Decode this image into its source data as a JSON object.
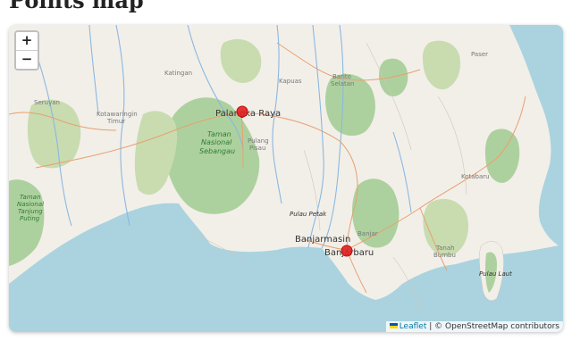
{
  "page": {
    "title": "Points map"
  },
  "map": {
    "colors": {
      "sea": "#aad3df",
      "land": "#f2efe9",
      "forest": "#add19e",
      "park": "#c8dcb0",
      "marker": "#e02020",
      "river": "#8ab8e0",
      "road": "#e8a070"
    },
    "places": {
      "palangka_raya": "Palangka Raya",
      "banjarmasin": "Banjarmasin",
      "banjarbaru": "Banjarbaru",
      "kapuas": "Kapuas",
      "katingan": "Katingan",
      "seruyan": "Seruyan",
      "kotawaringin_1": "Kotawaringin",
      "kotawaringin_2": "Timur",
      "barito_1": "Barito",
      "barito_2": "Selatan",
      "paser": "Paser",
      "pulang_1": "Pulang",
      "pulang_2": "Pisau",
      "pulau_petak": "Pulau Petak",
      "banjar": "Banjar",
      "kotabaru": "Kotabaru",
      "tanah_1": "Tanah",
      "tanah_2": "Bumbu",
      "pulau_laut": "Pulau Laut",
      "sebangau_1": "Taman",
      "sebangau_2": "Nasional",
      "sebangau_3": "Sebangau",
      "tanjung_1": "Taman",
      "tanjung_2": "Nasional",
      "tanjung_3": "Tanjung",
      "tanjung_4": "Puting"
    },
    "markers": [
      {
        "name": "Palangka Raya",
        "lat": -2.21,
        "lon": 113.92
      },
      {
        "name": "Banjarbaru",
        "lat": -3.44,
        "lon": 114.83
      }
    ],
    "zoom": {
      "in_label": "+",
      "out_label": "−"
    },
    "attribution": {
      "leaflet_label": "Leaflet",
      "separator": "|",
      "osm_text": "© OpenStreetMap contributors"
    }
  }
}
